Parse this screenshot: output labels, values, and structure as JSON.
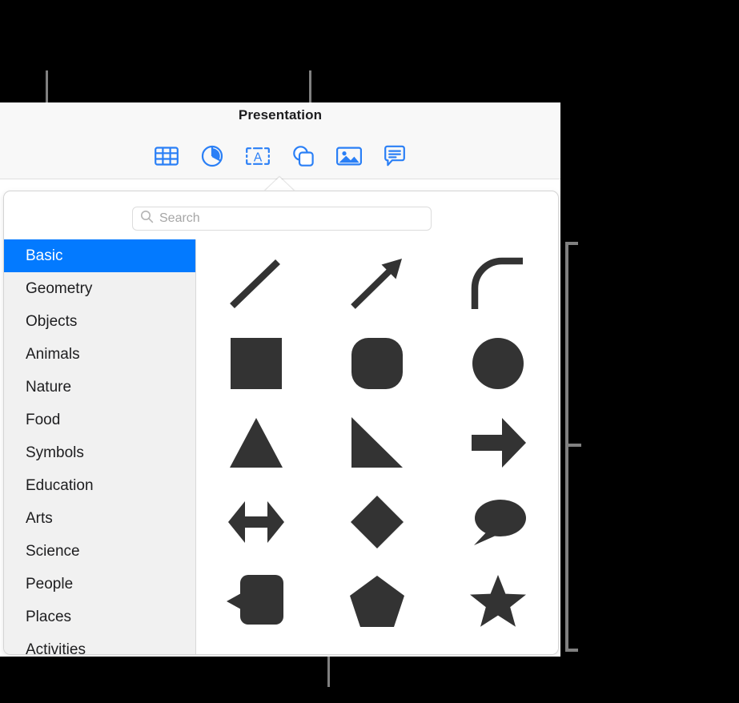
{
  "window": {
    "document_title": "Presentation"
  },
  "toolbar": {
    "items": [
      {
        "name": "table-icon",
        "label": "Table"
      },
      {
        "name": "chart-icon",
        "label": "Chart"
      },
      {
        "name": "text-icon",
        "label": "Text"
      },
      {
        "name": "shape-icon",
        "label": "Shape"
      },
      {
        "name": "media-icon",
        "label": "Media"
      },
      {
        "name": "comment-icon",
        "label": "Comment"
      }
    ],
    "accent_color": "#037aff"
  },
  "popover": {
    "search": {
      "placeholder": "Search",
      "value": "",
      "icon": "search-icon"
    },
    "sidebar": {
      "selected": "Basic",
      "items": [
        {
          "label": "Basic",
          "selected": true
        },
        {
          "label": "Geometry",
          "selected": false
        },
        {
          "label": "Objects",
          "selected": false
        },
        {
          "label": "Animals",
          "selected": false
        },
        {
          "label": "Nature",
          "selected": false
        },
        {
          "label": "Food",
          "selected": false
        },
        {
          "label": "Symbols",
          "selected": false
        },
        {
          "label": "Education",
          "selected": false
        },
        {
          "label": "Arts",
          "selected": false
        },
        {
          "label": "Science",
          "selected": false
        },
        {
          "label": "People",
          "selected": false
        },
        {
          "label": "Places",
          "selected": false
        },
        {
          "label": "Activities",
          "selected": false
        }
      ],
      "selected_background": "#037aff",
      "background": "#f1f1f1"
    },
    "shapes": {
      "fill_color": "#333333",
      "rows": [
        [
          "line-shape",
          "arrow-shape",
          "curved-line-shape"
        ],
        [
          "square-shape",
          "rounded-square-shape",
          "circle-shape"
        ],
        [
          "triangle-shape",
          "right-triangle-shape",
          "right-arrow-shape"
        ],
        [
          "double-arrow-shape",
          "diamond-shape",
          "oval-callout-shape"
        ],
        [
          "rounded-callout-shape",
          "pentagon-shape",
          "star-shape"
        ]
      ]
    }
  },
  "annotations": {
    "line_color": "#808080",
    "callouts": [
      {
        "name": "callout-line-sidebar",
        "target": "category-sidebar"
      },
      {
        "name": "callout-line-shape-button",
        "target": "shape-toolbar-button"
      },
      {
        "name": "callout-line-shapes-grid",
        "target": "shapes-grid"
      },
      {
        "name": "callout-bracket-shapes",
        "target": "shapes-grid"
      }
    ]
  }
}
